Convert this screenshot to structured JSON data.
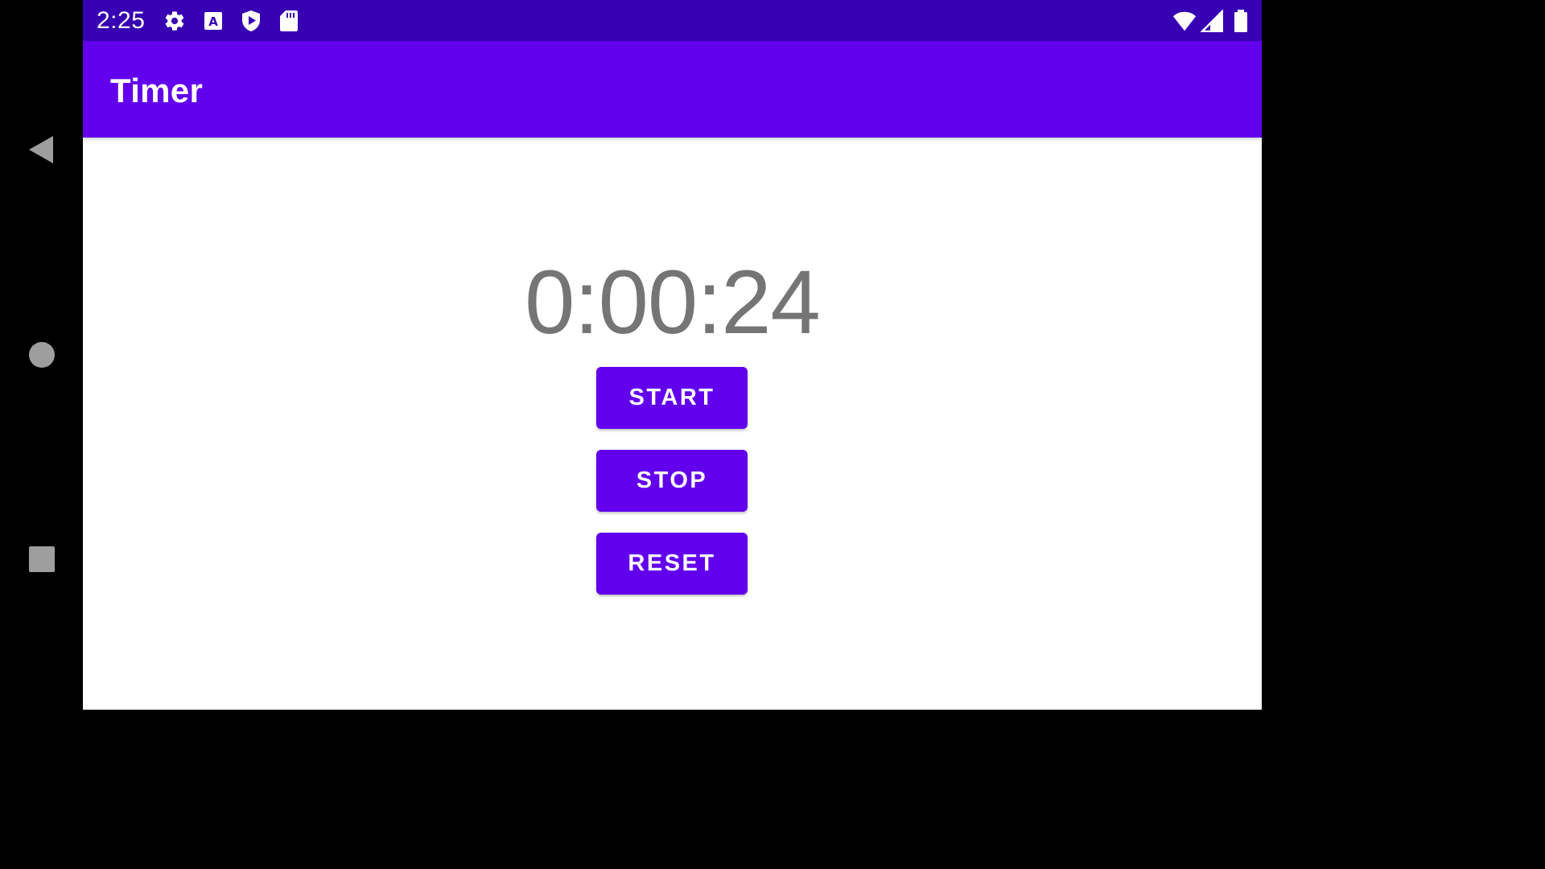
{
  "system_nav": {
    "back_icon": "back-triangle-icon",
    "home_icon": "home-circle-icon",
    "recents_icon": "recents-square-icon"
  },
  "status_bar": {
    "time": "2:25",
    "notification_icons": [
      "gear-icon",
      "font-a-icon",
      "play-shield-icon",
      "sd-card-icon"
    ],
    "system_icons": [
      "wifi-icon",
      "cell-signal-icon",
      "battery-icon"
    ]
  },
  "app_bar": {
    "title": "Timer"
  },
  "timer": {
    "display": "0:00:24"
  },
  "buttons": {
    "start": "START",
    "stop": "STOP",
    "reset": "RESET"
  },
  "colors": {
    "status_bar": "#3700b3",
    "primary": "#6200ee",
    "timer_text": "#757575",
    "nav_bar": "#000000"
  }
}
